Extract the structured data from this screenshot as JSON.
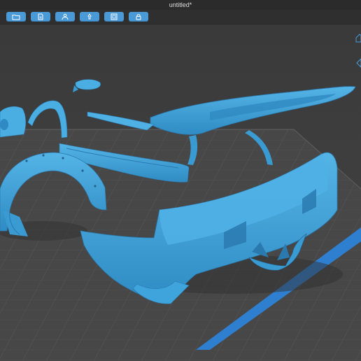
{
  "window": {
    "title": "untitled*"
  },
  "toolbar": {
    "buttons": [
      {
        "icon": "folder-icon"
      },
      {
        "icon": "document-icon"
      },
      {
        "icon": "users-icon"
      },
      {
        "icon": "support-icon"
      },
      {
        "icon": "layout-icon"
      },
      {
        "icon": "lock-icon"
      }
    ]
  },
  "colors": {
    "accent": "#4a9ad8",
    "model": "#3d9fd6",
    "background": "#3d3d3d",
    "grid": "#4a4a4a",
    "build_edge": "#2f7fd0"
  },
  "viewport": {
    "nav_icons": [
      "home-view-icon",
      "orthographic-view-icon"
    ]
  }
}
